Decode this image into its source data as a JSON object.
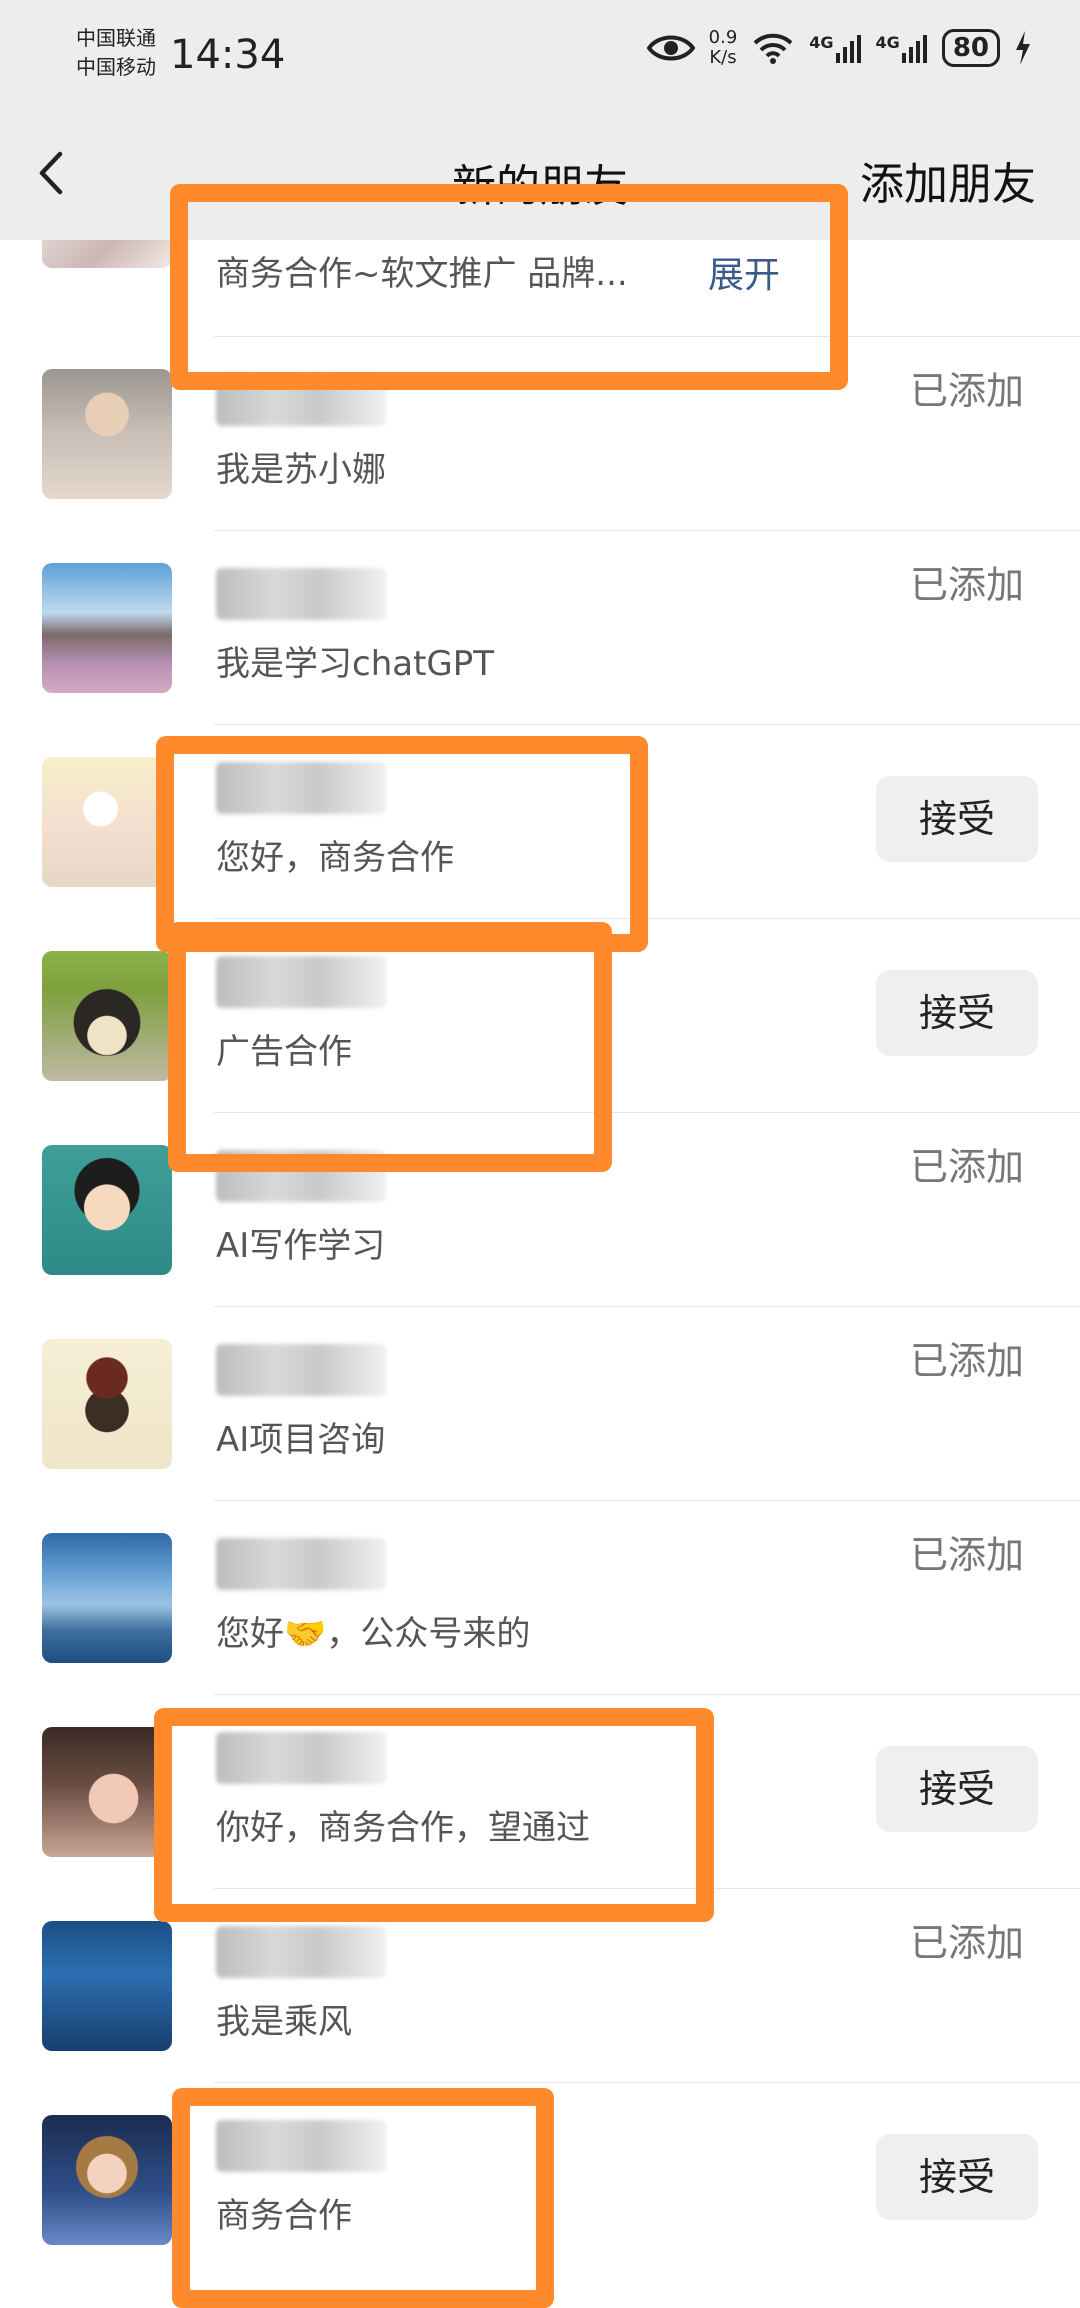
{
  "status_bar": {
    "carrier_1": "中国联通",
    "carrier_2": "中国移动",
    "time": "14:34",
    "net_speed_value": "0.9",
    "net_speed_unit": "K/s",
    "network_1": "4G",
    "network_2": "4G",
    "battery": "80"
  },
  "nav": {
    "title": "新的朋友",
    "action": "添加朋友"
  },
  "partial_item": {
    "description": "商务合作~软文推广 品牌...",
    "expand_label": "展开"
  },
  "requests": [
    {
      "description": "我是苏小娜",
      "status": "已添加",
      "avatar": "child-photo"
    },
    {
      "description": "我是学习chatGPT",
      "status": "已添加",
      "avatar": "mountain-field-photo"
    },
    {
      "description": "您好，商务合作",
      "status": "接受",
      "avatar": "cartoon-cat-photo"
    },
    {
      "description": "广告合作",
      "status": "接受",
      "avatar": "dog-in-frog-hat-photo"
    },
    {
      "description": "AI写作学习",
      "status": "已添加",
      "avatar": "cartoon-man-glasses"
    },
    {
      "description": "AI项目咨询",
      "status": "已添加",
      "avatar": "hat-glasses-logo"
    },
    {
      "description": "您好🤝，公众号来的",
      "status": "已添加",
      "avatar": "blue-mountains-photo"
    },
    {
      "description": "你好，商务合作，望通过",
      "status": "接受",
      "avatar": "girl-photo"
    },
    {
      "description": "我是乘风",
      "status": "已添加",
      "avatar": "aquarium-photo"
    },
    {
      "description": "商务合作",
      "status": "接受",
      "avatar": "cartoon-princess"
    }
  ],
  "colors": {
    "highlight": "#ff8a2b",
    "link": "#3b5a8c",
    "header_bg": "#ededed"
  }
}
